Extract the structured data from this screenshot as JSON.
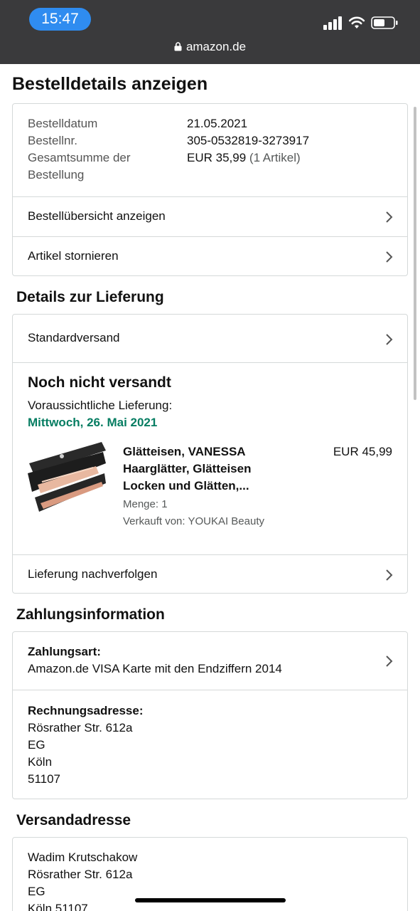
{
  "status": {
    "time": "15:47",
    "url": "amazon.de"
  },
  "page": {
    "title": "Bestelldetails anzeigen"
  },
  "order": {
    "date_label": "Bestelldatum",
    "date_value": "21.05.2021",
    "number_label": "Bestellnr.",
    "number_value": "305-0532819-3273917",
    "total_label_line1": "Gesamtsumme der",
    "total_label_line2": "Bestellung",
    "total_value": "EUR 35,99",
    "total_items": "(1 Artikel)",
    "overview_link": "Bestellübersicht anzeigen",
    "cancel_link": "Artikel stornieren"
  },
  "delivery": {
    "section_title": "Details zur Lieferung",
    "shipping_method": "Standardversand",
    "status": "Noch nicht versandt",
    "expected_label": "Voraussichtliche Lieferung:",
    "expected_date": "Mittwoch, 26. Mai 2021",
    "product": {
      "title_line1": "Glätteisen, VANESSA",
      "title_line2": "Haarglätter, Glätteisen",
      "title_line3": "Locken und Glätten,...",
      "price": "EUR 45,99",
      "quantity": "Menge: 1",
      "seller": "Verkauft von: YOUKAI Beauty",
      "image_icon": "hair-straightener-image"
    },
    "track_link": "Lieferung nachverfolgen"
  },
  "payment": {
    "section_title": "Zahlungsinformation",
    "method_label": "Zahlungsart:",
    "method_value": "Amazon.de VISA Karte mit den Endziffern 2014",
    "billing_label": "Rechnungsadresse:",
    "billing_lines": [
      "Rösrather Str. 612a",
      "EG",
      "Köln",
      "51107"
    ]
  },
  "shipping_address": {
    "section_title": "Versandadresse",
    "lines": [
      "Wadim Krutschakow",
      "Rösrather Str. 612a",
      "EG",
      "Köln 51107"
    ]
  },
  "colors": {
    "accent_green": "#067d62",
    "time_pill": "#2f8cf0",
    "topbar": "#3a3a3c",
    "border": "#d5d9d9"
  }
}
